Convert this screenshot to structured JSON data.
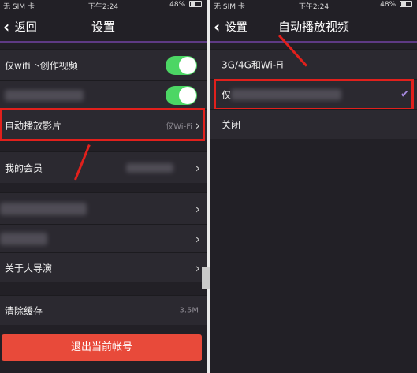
{
  "status": {
    "carrier": "无 SIM 卡",
    "time": "下午2:24",
    "battery": "48%"
  },
  "left": {
    "back_label": "返回",
    "title": "设置",
    "rows": {
      "wifi_video": "仅wifi下创作视频",
      "autoplay": "自动播放影片",
      "autoplay_value": "仅Wi-Fi",
      "member": "我的会员",
      "about": "关于大导演",
      "clear_cache": "清除缓存",
      "cache_size": "3.5M"
    },
    "logout": "退出当前帐号",
    "colors": {
      "toggle_on": "#4cd664",
      "logout": "#e84a3a",
      "highlight": "#e1201c"
    }
  },
  "right": {
    "back_label": "设置",
    "title": "自动播放视频",
    "options": [
      "3G/4G和Wi-Fi",
      "仅",
      "关闭"
    ],
    "selected_index": 1,
    "colors": {
      "check": "#a78ae0"
    }
  }
}
